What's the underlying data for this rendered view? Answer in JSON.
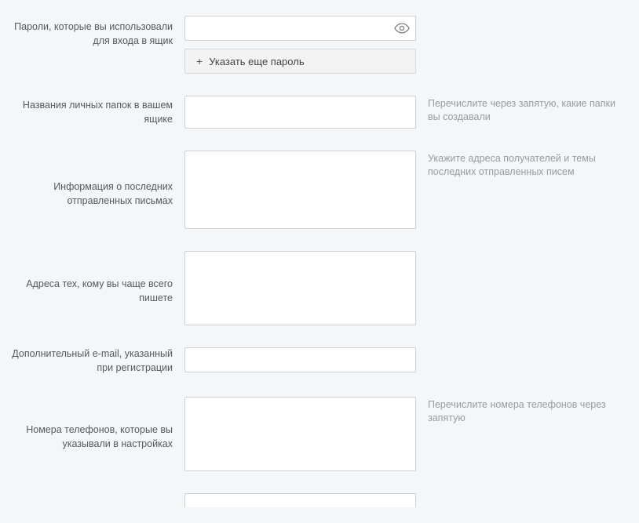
{
  "fields": {
    "passwords": {
      "label": "Пароли, которые вы использовали для входа в ящик",
      "value": "",
      "add_button": "Указать еще пароль"
    },
    "folders": {
      "label": "Названия личных папок в вашем ящике",
      "value": "",
      "hint": "Перечислите через запятую, какие папки вы создавали"
    },
    "sent_info": {
      "label": "Информация о последних отправленных письмах",
      "value": "",
      "hint": "Укажите адреса получателей и темы последних отправленных писем"
    },
    "frequent_recipients": {
      "label": "Адреса тех, кому вы чаще всего пишете",
      "value": ""
    },
    "additional_email": {
      "label": "Дополнительный e-mail, указанный при регистрации",
      "value": ""
    },
    "phone_numbers": {
      "label": "Номера телефонов, которые вы указывали в настройках",
      "value": "",
      "hint": "Перечислите номера телефонов через запятую"
    }
  }
}
